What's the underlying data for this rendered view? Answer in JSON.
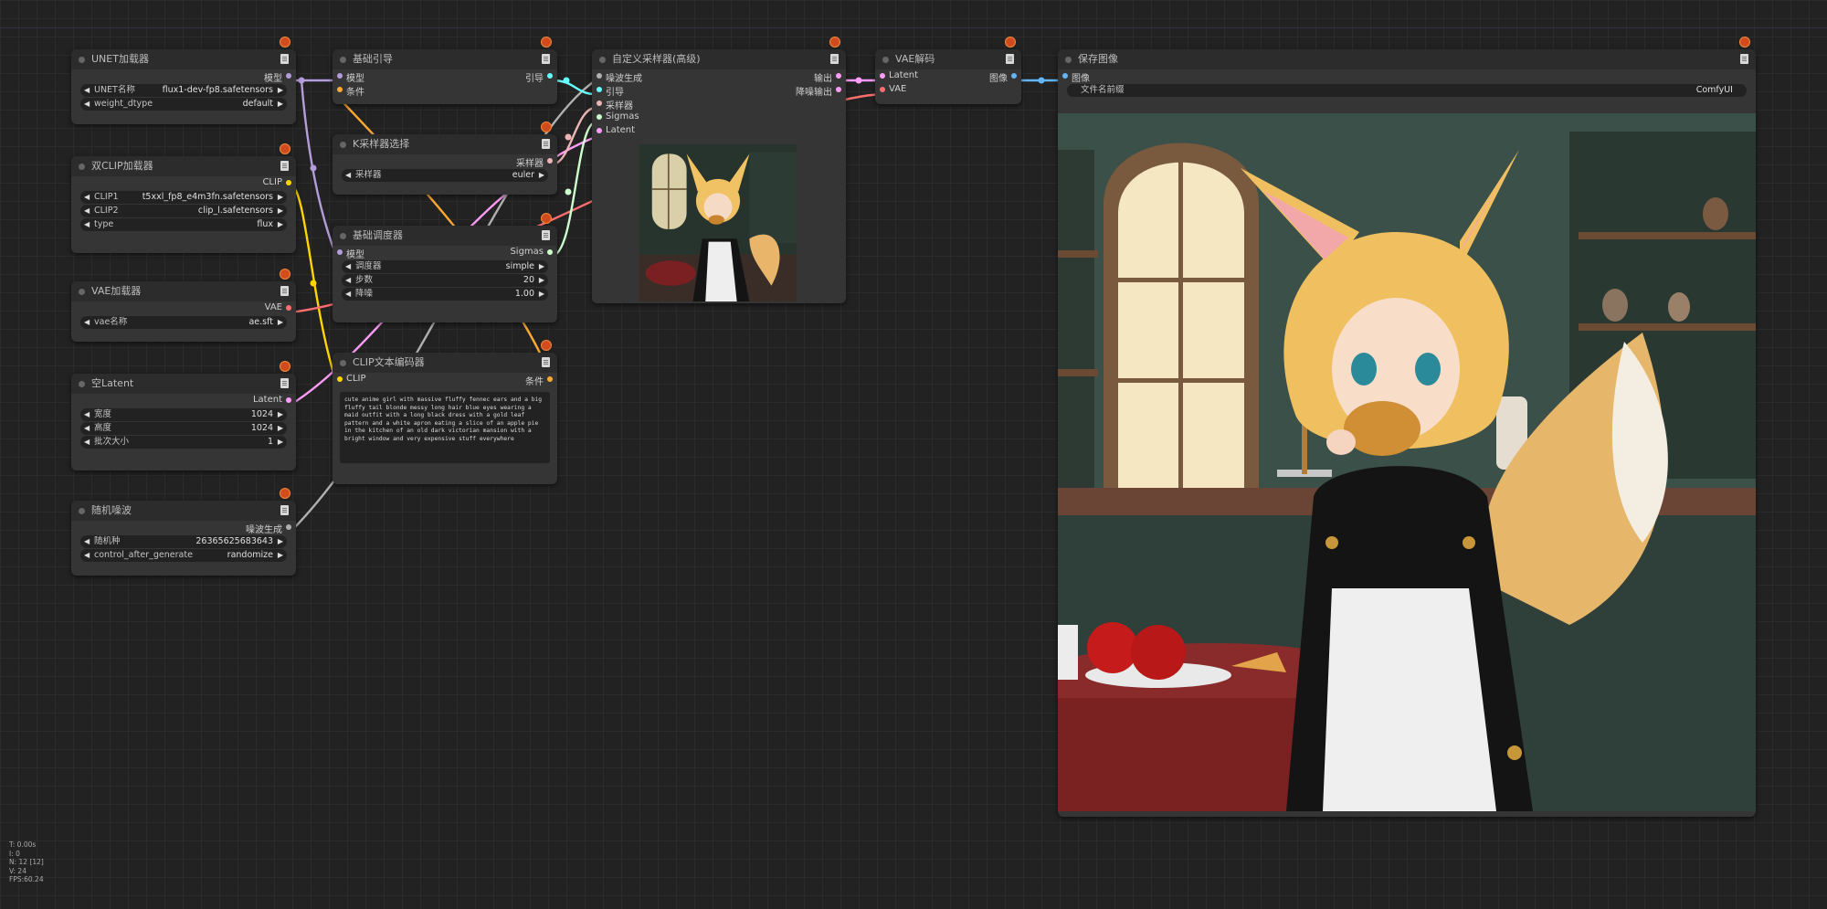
{
  "canvas": {
    "link_colors": {
      "model": "#b39ddb",
      "clip": "#ffd500",
      "vae": "#ff6e6e",
      "latent": "#ff9cf9",
      "noise": "#b0b0b0",
      "conditioning": "#ffa931",
      "guider": "#66ffff",
      "sampler": "#ecb4b4",
      "sigmas": "#cdffcd",
      "image": "#64b5f6"
    }
  },
  "nodes": {
    "unet": {
      "title": "UNET加载器",
      "out_model": "模型",
      "w1_label": "UNET名称",
      "w1_value": "flux1-dev-fp8.safetensors",
      "w2_label": "weight_dtype",
      "w2_value": "default"
    },
    "dualclip": {
      "title": "双CLIP加载器",
      "out_clip": "CLIP",
      "w1_label": "CLIP1",
      "w1_value": "t5xxl_fp8_e4m3fn.safetensors",
      "w2_label": "CLIP2",
      "w2_value": "clip_l.safetensors",
      "w3_label": "type",
      "w3_value": "flux"
    },
    "vaeloader": {
      "title": "VAE加载器",
      "out_vae": "VAE",
      "w1_label": "vae名称",
      "w1_value": "ae.sft"
    },
    "emptylatent": {
      "title": "空Latent",
      "out_latent": "Latent",
      "w1_label": "宽度",
      "w1_value": "1024",
      "w2_label": "高度",
      "w2_value": "1024",
      "w3_label": "批次大小",
      "w3_value": "1"
    },
    "noise": {
      "title": "随机噪波",
      "out_noise": "噪波生成",
      "w1_label": "随机种",
      "w1_value": "263656256836​43",
      "w2_label": "control_after_generate",
      "w2_value": "randomize"
    },
    "guider": {
      "title": "基础引导",
      "in_model": "模型",
      "in_cond": "条件",
      "out_guider": "引导"
    },
    "ksampler": {
      "title": "K采样器选择",
      "out_sampler": "采样器",
      "w1_label": "采样器",
      "w1_value": "euler"
    },
    "scheduler": {
      "title": "基础调度器",
      "in_model": "模型",
      "out_sigmas": "Sigmas",
      "w1_label": "调度器",
      "w1_value": "simple",
      "w2_label": "步数",
      "w2_value": "20",
      "w3_label": "降噪",
      "w3_value": "1.00"
    },
    "clipencode": {
      "title": "CLIP文本编码器",
      "in_clip": "CLIP",
      "out_cond": "条件",
      "text": "cute anime girl with massive fluffy fennec ears and a big fluffy tail blonde messy long hair blue eyes wearing a maid outfit with a long black dress with a gold leaf pattern and a white apron eating a slice of an apple pie in the kitchen of an old dark victorian mansion with a bright window and very expensive stuff everywhere"
    },
    "customsampler": {
      "title": "自定义采样器(高级)",
      "in_noise": "噪波生成",
      "in_guider": "引导",
      "in_sampler": "采样器",
      "in_sigmas": "Sigmas",
      "in_latent": "Latent",
      "out1": "输出",
      "out2": "降噪输出"
    },
    "vaedecode": {
      "title": "VAE解码",
      "in_latent": "Latent",
      "in_vae": "VAE",
      "out_image": "图像"
    },
    "saveimage": {
      "title": "保存图像",
      "in_image": "图像",
      "w1_label": "文件名前缀",
      "w1_value": "ComfyUI"
    }
  },
  "stats": {
    "t": "T: 0.00s",
    "i": "I: 0",
    "n": "N: 12 [12]",
    "v": "V: 24",
    "fps": "FPS:60.24"
  }
}
